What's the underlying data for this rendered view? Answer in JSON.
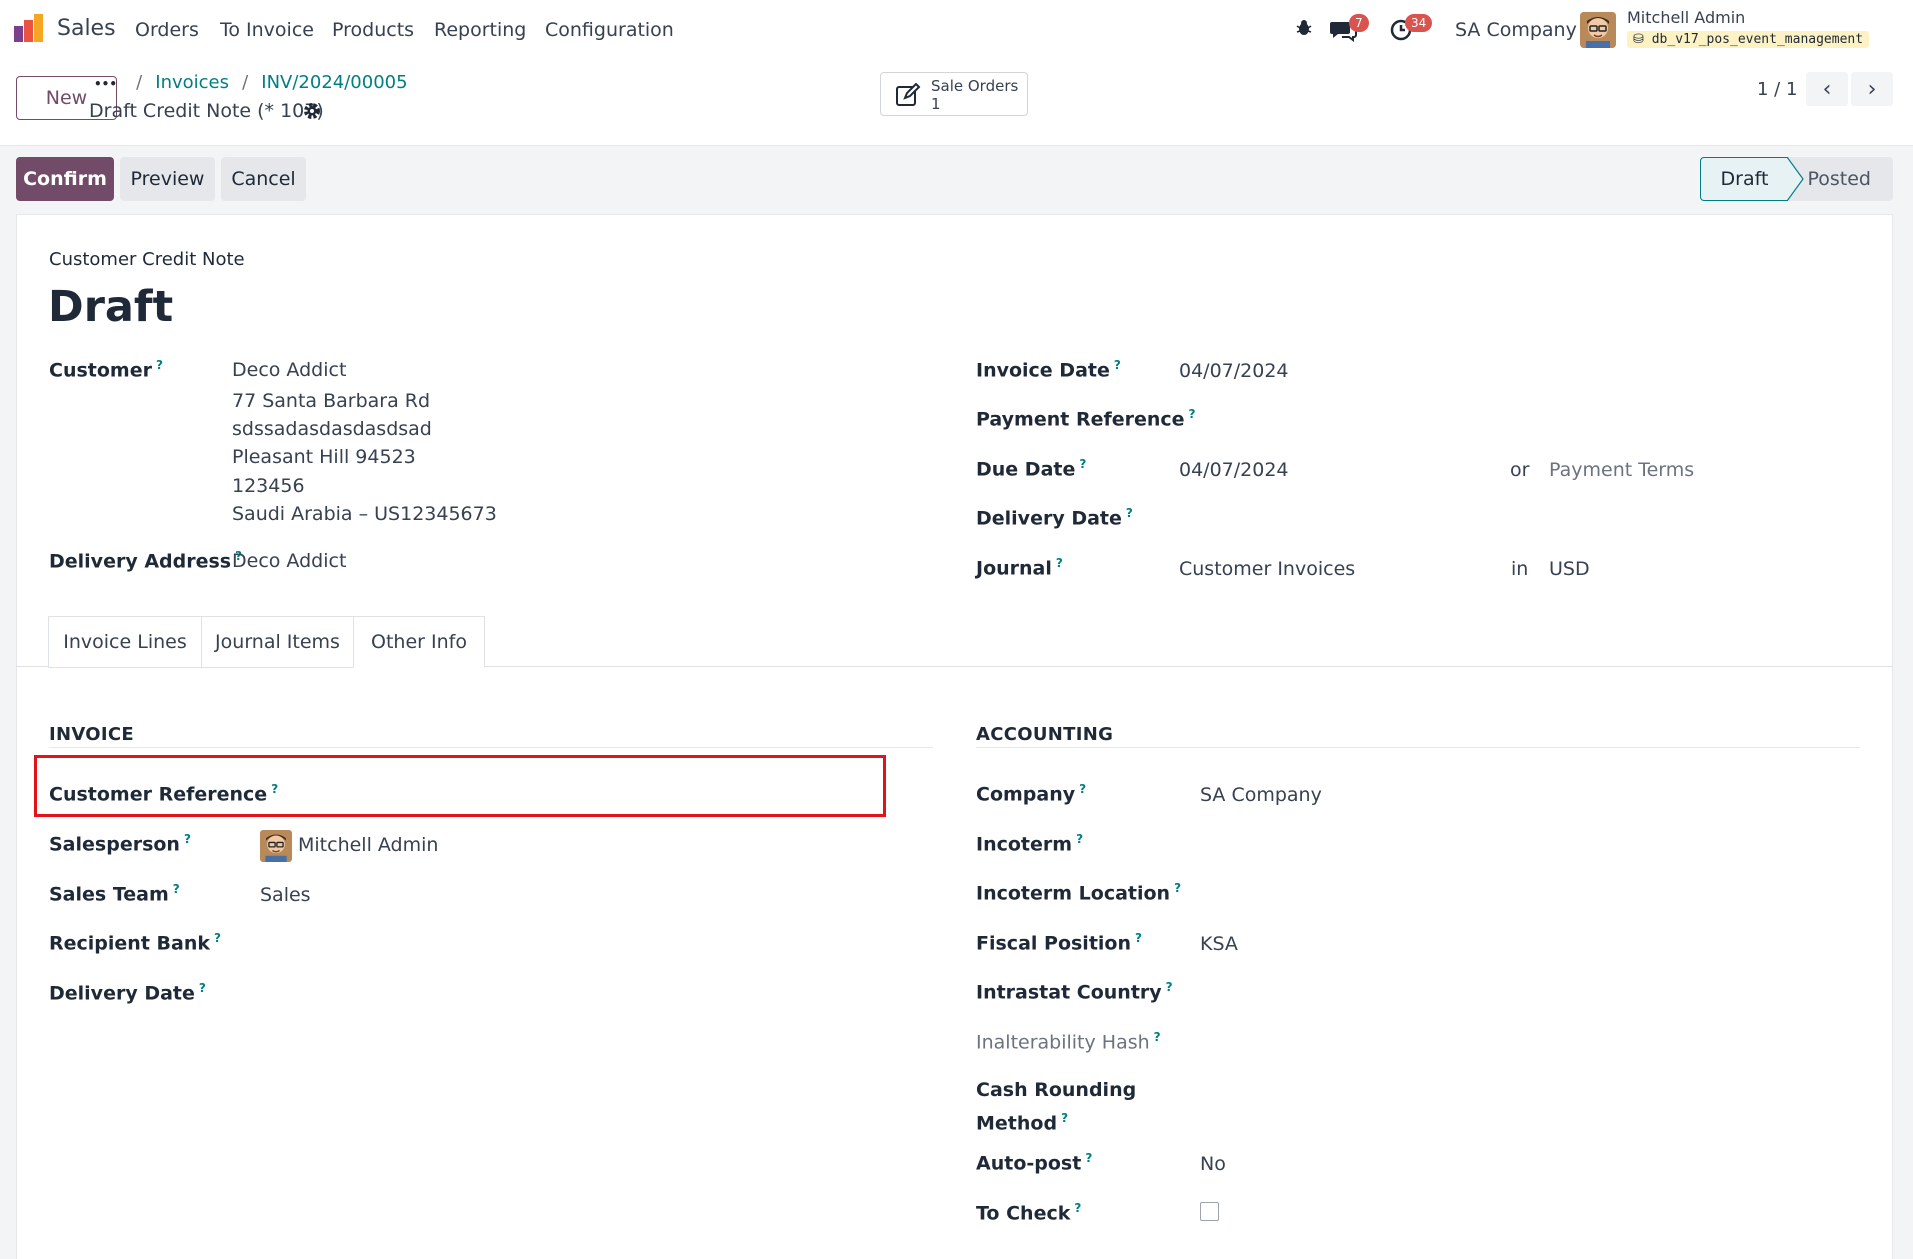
{
  "navbar": {
    "app_name": "Sales",
    "menu": [
      "Orders",
      "To Invoice",
      "Products",
      "Reporting",
      "Configuration"
    ],
    "messages_count": "7",
    "activities_count": "34",
    "company": "SA Company",
    "user_name": "Mitchell Admin",
    "database": "db_v17_pos_event_management"
  },
  "control_panel": {
    "new_label": "New",
    "breadcrumb_ellipsis": "•••",
    "breadcrumb": [
      "Invoices",
      "INV/2024/00005"
    ],
    "record_name": "Draft Credit Note (* 107)",
    "smart_button_label": "Sale Orders",
    "smart_button_count": "1",
    "pager": "1 / 1"
  },
  "actions": {
    "confirm": "Confirm",
    "preview": "Preview",
    "cancel": "Cancel"
  },
  "status": {
    "stages": [
      "Draft",
      "Posted"
    ],
    "current": "Draft"
  },
  "form": {
    "doc_type": "Customer Credit Note",
    "title": "Draft",
    "customer_label": "Customer",
    "customer_name": "Deco Addict",
    "customer_address": [
      "77 Santa Barbara Rd",
      "sdssadasdasdasdsad",
      "Pleasant Hill 94523",
      "123456",
      "Saudi Arabia – US12345673"
    ],
    "delivery_address_label": "Delivery Address",
    "delivery_address": "Deco Addict",
    "invoice_date_label": "Invoice Date",
    "invoice_date": "04/07/2024",
    "payment_reference_label": "Payment Reference",
    "due_date_label": "Due Date",
    "due_date": "04/07/2024",
    "or_label": "or",
    "payment_terms_placeholder": "Payment Terms",
    "delivery_date_label": "Delivery Date",
    "journal_label": "Journal",
    "journal": "Customer Invoices",
    "in_label": "in",
    "currency": "USD",
    "help_mark": "?"
  },
  "tabs": [
    "Invoice Lines",
    "Journal Items",
    "Other Info"
  ],
  "active_tab": "Other Info",
  "other_info": {
    "invoice_section": "INVOICE",
    "customer_reference_label": "Customer Reference",
    "salesperson_label": "Salesperson",
    "salesperson": "Mitchell Admin",
    "sales_team_label": "Sales Team",
    "sales_team": "Sales",
    "recipient_bank_label": "Recipient Bank",
    "delivery_date_label": "Delivery Date",
    "accounting_section": "ACCOUNTING",
    "company_label": "Company",
    "company": "SA Company",
    "incoterm_label": "Incoterm",
    "incoterm_location_label": "Incoterm Location",
    "fiscal_position_label": "Fiscal Position",
    "fiscal_position": "KSA",
    "intrastat_country_label": "Intrastat Country",
    "inalterability_hash_label": "Inalterability Hash",
    "cash_rounding_label_1": "Cash Rounding",
    "cash_rounding_label_2": "Method",
    "auto_post_label": "Auto-post",
    "auto_post": "No",
    "to_check_label": "To Check",
    "to_check": false
  },
  "colors": {
    "brand": "#714b67",
    "link": "#017e84",
    "highlight": "#e3131a",
    "badge": "#d9534f"
  }
}
